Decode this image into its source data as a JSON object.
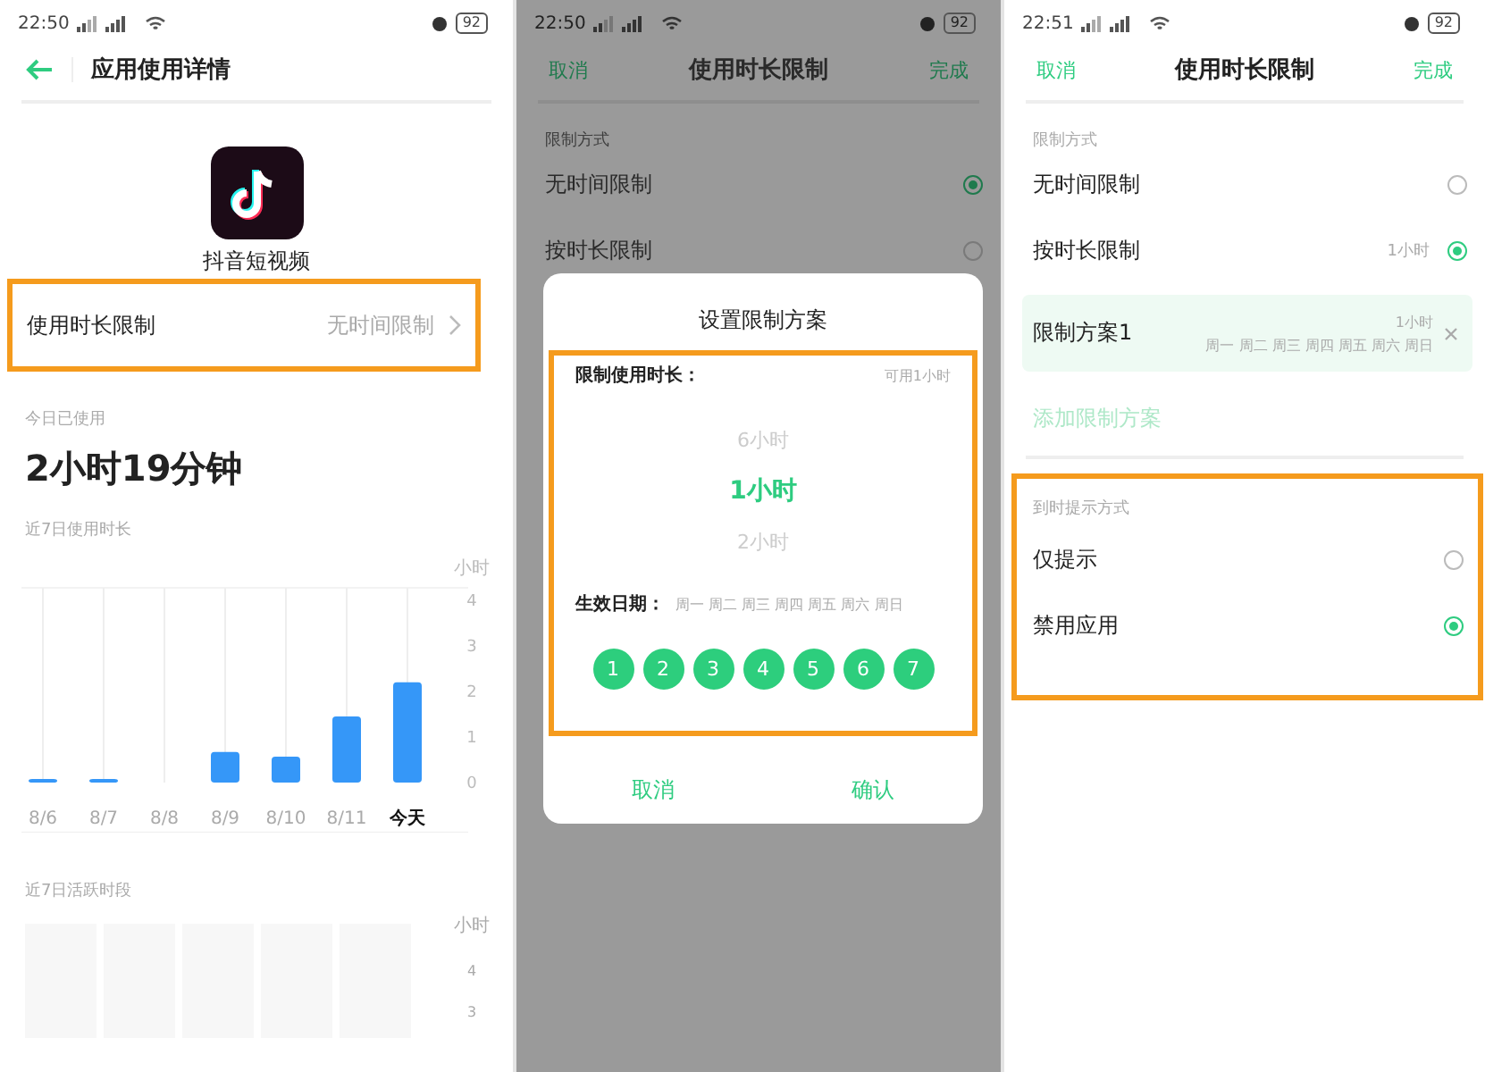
{
  "usage_screen": {
    "status": {
      "time": "22:50",
      "battery": "92"
    },
    "title": "应用使用详情",
    "app_name": "抖音短视频",
    "limit_row": {
      "label": "使用时长限制",
      "value": "无时间限制",
      "highlighted": true
    },
    "today": {
      "label": "今日已使用",
      "value": "2小时19分钟"
    },
    "usage_chart": {
      "title": "近7日使用时长",
      "chart_data": {
        "type": "bar",
        "ylabel": "小时",
        "categories": [
          "8/6",
          "8/7",
          "8/8",
          "8/9",
          "8/10",
          "8/11",
          "今天"
        ],
        "values": [
          0.07,
          0.05,
          0,
          0.67,
          0.57,
          1.45,
          2.2
        ],
        "ylim": [
          0,
          4
        ],
        "yticks": [
          0,
          1,
          2,
          3,
          4
        ],
        "grid": true
      }
    },
    "active_chart": {
      "title": "近7日活跃时段",
      "unit": "小时",
      "ticks": [
        "4",
        "3"
      ]
    }
  },
  "dialog_screen": {
    "status": {
      "time": "22:50",
      "battery": "92"
    },
    "header": {
      "cancel": "取消",
      "title": "使用时长限制",
      "done": "完成"
    },
    "section_label": "限制方式",
    "options": [
      {
        "label": "无时间限制",
        "selected": true
      },
      {
        "label": "按时长限制",
        "selected": false
      }
    ],
    "dialog": {
      "title": "设置限制方案",
      "highlighted": true,
      "duration_label": "限制使用时长：",
      "available": "可用1小时",
      "picker": [
        {
          "label": "6小时",
          "selected": false
        },
        {
          "label": "1小时",
          "selected": true
        },
        {
          "label": "2小时",
          "selected": false
        }
      ],
      "days_label": "生效日期：",
      "days_text": "周一 周二 周三 周四 周五 周六 周日",
      "days": [
        {
          "label": "1",
          "selected": true
        },
        {
          "label": "2",
          "selected": true
        },
        {
          "label": "3",
          "selected": true
        },
        {
          "label": "4",
          "selected": true
        },
        {
          "label": "5",
          "selected": true
        },
        {
          "label": "6",
          "selected": true
        },
        {
          "label": "7",
          "selected": true
        }
      ],
      "buttons": [
        "取消",
        "确认"
      ]
    }
  },
  "limit_screen": {
    "status": {
      "time": "22:51",
      "battery": "92"
    },
    "header": {
      "cancel": "取消",
      "title": "使用时长限制",
      "done": "完成"
    },
    "section_label": "限制方式",
    "options": [
      {
        "label": "无时间限制",
        "selected": false
      },
      {
        "label": "按时长限制",
        "value": "1小时",
        "selected": true
      }
    ],
    "plan": {
      "name": "限制方案1",
      "duration": "1小时",
      "days": "周一 周二 周三 周四 周五 周六 周日"
    },
    "add_plan": "添加限制方案",
    "alert": {
      "title": "到时提示方式",
      "highlighted": true,
      "options": [
        {
          "label": "仅提示",
          "selected": false
        },
        {
          "label": "禁用应用",
          "selected": true
        }
      ]
    }
  }
}
